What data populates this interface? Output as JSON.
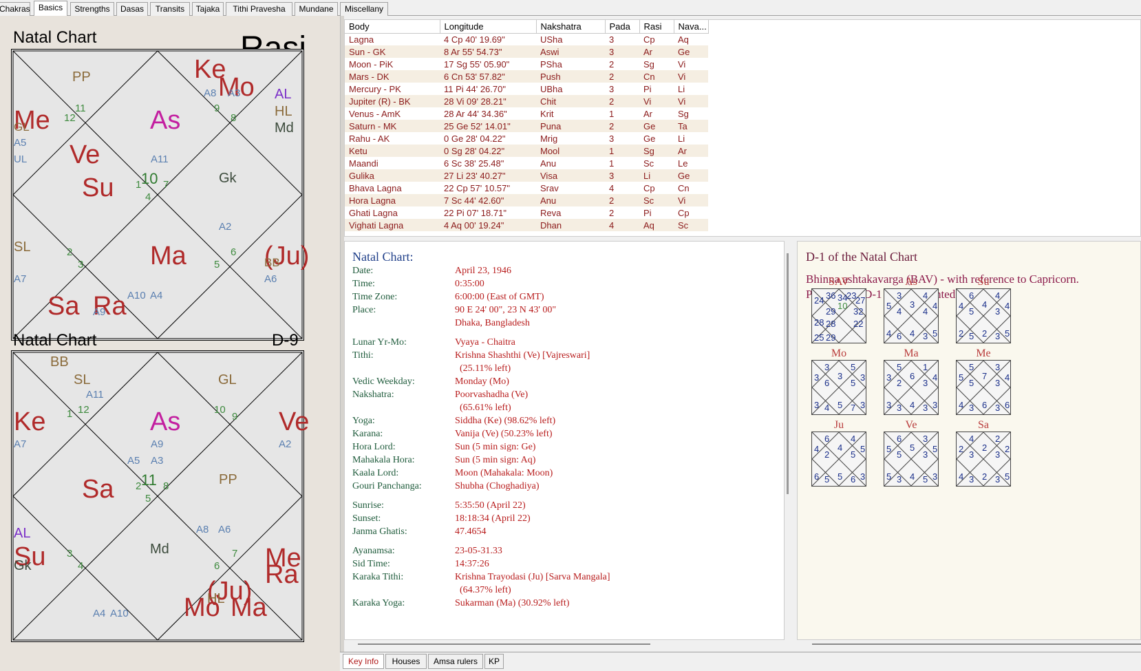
{
  "tabs": [
    "Chakras",
    "Basics",
    "Strengths",
    "Dasas",
    "Transits",
    "Tajaka",
    "Tithi Pravesha",
    "Mundane",
    "Miscellany"
  ],
  "active_tab": "Basics",
  "rasi_chart": {
    "title": "Natal Chart",
    "division": "Rasi",
    "labels": {
      "pp": "PP",
      "ke": "Ke",
      "mo": "Mo",
      "a8": "A8",
      "a3": "A3",
      "al": "AL",
      "hl": "HL",
      "md": "Md",
      "me": "Me",
      "gl": "GL",
      "a5": "A5",
      "ul": "UL",
      "as": "As",
      "ve": "Ve",
      "su": "Su",
      "a11": "A11",
      "gk": "Gk",
      "a2": "A2",
      "sl": "SL",
      "a7": "A7",
      "ma": "Ma",
      "ju": "(Ju)",
      "bb": "BB",
      "a6": "A6",
      "sa": "Sa",
      "ra": "Ra",
      "a9": "A9",
      "a10": "A10",
      "a4": "A4",
      "n1": "1",
      "n2": "2",
      "n3": "3",
      "n4": "4",
      "n5": "5",
      "n6": "6",
      "n7": "7",
      "n8": "8",
      "n9": "9",
      "n10": "10",
      "n11": "11",
      "n12": "12"
    }
  },
  "navamsa_chart": {
    "title": "Natal Chart",
    "division": "D-9",
    "labels": {
      "bb": "BB",
      "sl": "SL",
      "a11": "A11",
      "gl": "GL",
      "ke": "Ke",
      "as": "As",
      "ve": "Ve",
      "a7": "A7",
      "a9": "A9",
      "a2": "A2",
      "a5": "A5",
      "a3": "A3",
      "sa": "Sa",
      "pp": "PP",
      "al": "AL",
      "su": "Su",
      "gk": "Gk",
      "md": "Md",
      "a8": "A8",
      "a6": "A6",
      "me": "Me",
      "ra": "Ra",
      "ju": "(Ju)",
      "hl": "HL",
      "mo": "Mo",
      "ma": "Ma",
      "a4": "A4",
      "a10": "A10",
      "n1": "1",
      "n2": "2",
      "n3": "3",
      "n4": "4",
      "n5": "5",
      "n6": "6",
      "n7": "7",
      "n8": "8",
      "n9": "9",
      "n10": "10",
      "n11": "11",
      "n12": "12"
    }
  },
  "planet_table": {
    "headers": [
      "Body",
      "Longitude",
      "Nakshatra",
      "Pada",
      "Rasi",
      "Nava..."
    ],
    "rows": [
      [
        "Lagna",
        "4 Cp 40' 19.69\"",
        "USha",
        "3",
        "Cp",
        "Aq"
      ],
      [
        "Sun - GK",
        "8 Ar 55' 54.73\"",
        "Aswi",
        "3",
        "Ar",
        "Ge"
      ],
      [
        "Moon - PiK",
        "17 Sg 55' 05.90\"",
        "PSha",
        "2",
        "Sg",
        "Vi"
      ],
      [
        "Mars - DK",
        "6 Cn 53' 57.82\"",
        "Push",
        "2",
        "Cn",
        "Vi"
      ],
      [
        "Mercury - PK",
        "11 Pi 44' 26.70\"",
        "UBha",
        "3",
        "Pi",
        "Li"
      ],
      [
        "Jupiter (R) - BK",
        "28 Vi 09' 28.21\"",
        "Chit",
        "2",
        "Vi",
        "Vi"
      ],
      [
        "Venus - AmK",
        "28 Ar 44' 34.36\"",
        "Krit",
        "1",
        "Ar",
        "Sg"
      ],
      [
        "Saturn - MK",
        "25 Ge 52' 14.01\"",
        "Puna",
        "2",
        "Ge",
        "Ta"
      ],
      [
        "Rahu - AK",
        "0 Ge 28' 04.22\"",
        "Mrig",
        "3",
        "Ge",
        "Li"
      ],
      [
        "Ketu",
        "0 Sg 28' 04.22\"",
        "Mool",
        "1",
        "Sg",
        "Ar"
      ],
      [
        "Maandi",
        "6 Sc 38' 25.48\"",
        "Anu",
        "1",
        "Sc",
        "Le"
      ],
      [
        "Gulika",
        "27 Li 23' 40.27\"",
        "Visa",
        "3",
        "Li",
        "Ge"
      ],
      [
        "Bhava Lagna",
        "22 Cp 57' 10.57\"",
        "Srav",
        "4",
        "Cp",
        "Cn"
      ],
      [
        "Hora Lagna",
        "7 Sc 44' 42.60\"",
        "Anu",
        "2",
        "Sc",
        "Vi"
      ],
      [
        "Ghati Lagna",
        "22 Pi 07' 18.71\"",
        "Reva",
        "2",
        "Pi",
        "Cp"
      ],
      [
        "Vighati Lagna",
        "4 Aq 00' 19.24\"",
        "Dhan",
        "4",
        "Aq",
        "Sc"
      ]
    ]
  },
  "key_info": {
    "heading": "Natal Chart:",
    "items": [
      {
        "label": "Date:",
        "value": "April 23, 1946"
      },
      {
        "label": "Time:",
        "value": "0:35:00"
      },
      {
        "label": "Time Zone:",
        "value": "6:00:00 (East of GMT)"
      },
      {
        "label": "Place:",
        "value": "90 E 24' 00\", 23 N 43' 00\""
      },
      {
        "label": "",
        "value": "Dhaka, Bangladesh"
      },
      {
        "label": "Lunar Yr-Mo:",
        "value": "Vyaya - Chaitra"
      },
      {
        "label": "Tithi:",
        "value": "Krishna Shashthi (Ve) [Vajreswari]"
      },
      {
        "label": "",
        "value": "(25.11% left)"
      },
      {
        "label": "Vedic Weekday:",
        "value": "Monday (Mo)"
      },
      {
        "label": "Nakshatra:",
        "value": "Poorvashadha (Ve)"
      },
      {
        "label": "",
        "value": "(65.61% left)"
      },
      {
        "label": "Yoga:",
        "value": "Siddha (Ke) (98.62% left)"
      },
      {
        "label": "Karana:",
        "value": "Vanija (Ve) (50.23% left)"
      },
      {
        "label": "Hora Lord:",
        "value": "Sun (5 min sign: Ge)"
      },
      {
        "label": "Mahakala Hora:",
        "value": "Sun (5 min sign: Aq)"
      },
      {
        "label": "Kaala Lord:",
        "value": "Moon (Mahakala: Moon)"
      },
      {
        "label": "Gouri Panchanga:",
        "value": "Shubha (Choghadiya)"
      },
      {
        "label": "Sunrise:",
        "value": "5:35:50 (April 22)"
      },
      {
        "label": "Sunset:",
        "value": "18:18:34 (April 22)"
      },
      {
        "label": "Janma Ghatis:",
        "value": "47.4654"
      },
      {
        "label": "Ayanamsa:",
        "value": "23-05-31.33"
      },
      {
        "label": "Sid Time:",
        "value": "14:37:26"
      },
      {
        "label": "Karaka Tithi:",
        "value": "Krishna Trayodasi (Ju) [Sarva Mangala]"
      },
      {
        "label": "",
        "value": "(64.37% left)"
      },
      {
        "label": "Karaka Yoga:",
        "value": "Sukarman (Ma) (30.92% left)"
      }
    ]
  },
  "bav": {
    "heading": "D-1 of the Natal Chart",
    "line1": "Bhinna ashtakavarga (BAV) - with reference to Capricorn.",
    "line2": "Positions in D-1 are highlighted.",
    "charts": [
      {
        "title": "SAV",
        "values": {
          "h1": "10",
          "h2": "34",
          "h3": "36",
          "h4": "24",
          "h5": "29",
          "h6": "28",
          "h7": "28",
          "h8": "25",
          "h9": "29",
          "h10": "22",
          "h11": "32",
          "h12": "27",
          "h13": "23"
        }
      },
      {
        "title": "As",
        "values": {
          "h1": "3",
          "h2": "3",
          "h3": "5",
          "h4": "4",
          "h5": "4",
          "h6": "6",
          "h7": "4",
          "h8": "3",
          "h9": "5",
          "h10": "4",
          "h11": "4",
          "h12": "4"
        }
      },
      {
        "title": "Su",
        "values": {
          "h1": "4",
          "h2": "6",
          "h3": "4",
          "h4": "5",
          "h5": "2",
          "h6": "5",
          "h7": "2",
          "h8": "3",
          "h9": "5",
          "h10": "3",
          "h11": "4",
          "h12": "4"
        }
      },
      {
        "title": "Mo",
        "values": {
          "h1": "3",
          "h2": "3",
          "h3": "3",
          "h4": "6",
          "h5": "3",
          "h6": "4",
          "h7": "5",
          "h8": "7",
          "h9": "3",
          "h10": "5",
          "h11": "3",
          "h12": "5"
        }
      },
      {
        "title": "Ma",
        "values": {
          "h1": "6",
          "h2": "5",
          "h3": "3",
          "h4": "2",
          "h5": "3",
          "h6": "3",
          "h7": "4",
          "h8": "3",
          "h9": "3",
          "h10": "3",
          "h11": "4",
          "h12": "1"
        }
      },
      {
        "title": "Me",
        "values": {
          "h1": "7",
          "h2": "5",
          "h3": "5",
          "h4": "5",
          "h5": "4",
          "h6": "3",
          "h7": "6",
          "h8": "3",
          "h9": "6",
          "h10": "3",
          "h11": "4",
          "h12": "3"
        }
      },
      {
        "title": "Ju",
        "values": {
          "h1": "4",
          "h2": "6",
          "h3": "4",
          "h4": "2",
          "h5": "6",
          "h6": "5",
          "h7": "5",
          "h8": "6",
          "h9": "3",
          "h10": "5",
          "h11": "5",
          "h12": "4"
        }
      },
      {
        "title": "Ve",
        "values": {
          "h1": "5",
          "h2": "6",
          "h3": "5",
          "h4": "5",
          "h5": "5",
          "h6": "3",
          "h7": "4",
          "h8": "5",
          "h9": "3",
          "h10": "3",
          "h11": "5",
          "h12": "3"
        }
      },
      {
        "title": "Sa",
        "values": {
          "h1": "2",
          "h2": "4",
          "h3": "2",
          "h4": "3",
          "h5": "4",
          "h6": "3",
          "h7": "2",
          "h8": "3",
          "h9": "5",
          "h10": "3",
          "h11": "2",
          "h12": "2"
        }
      }
    ]
  },
  "bottom_tabs": [
    "Key Info",
    "Houses",
    "Amsa rulers",
    "KP"
  ],
  "active_bottom_tab": "Key Info"
}
